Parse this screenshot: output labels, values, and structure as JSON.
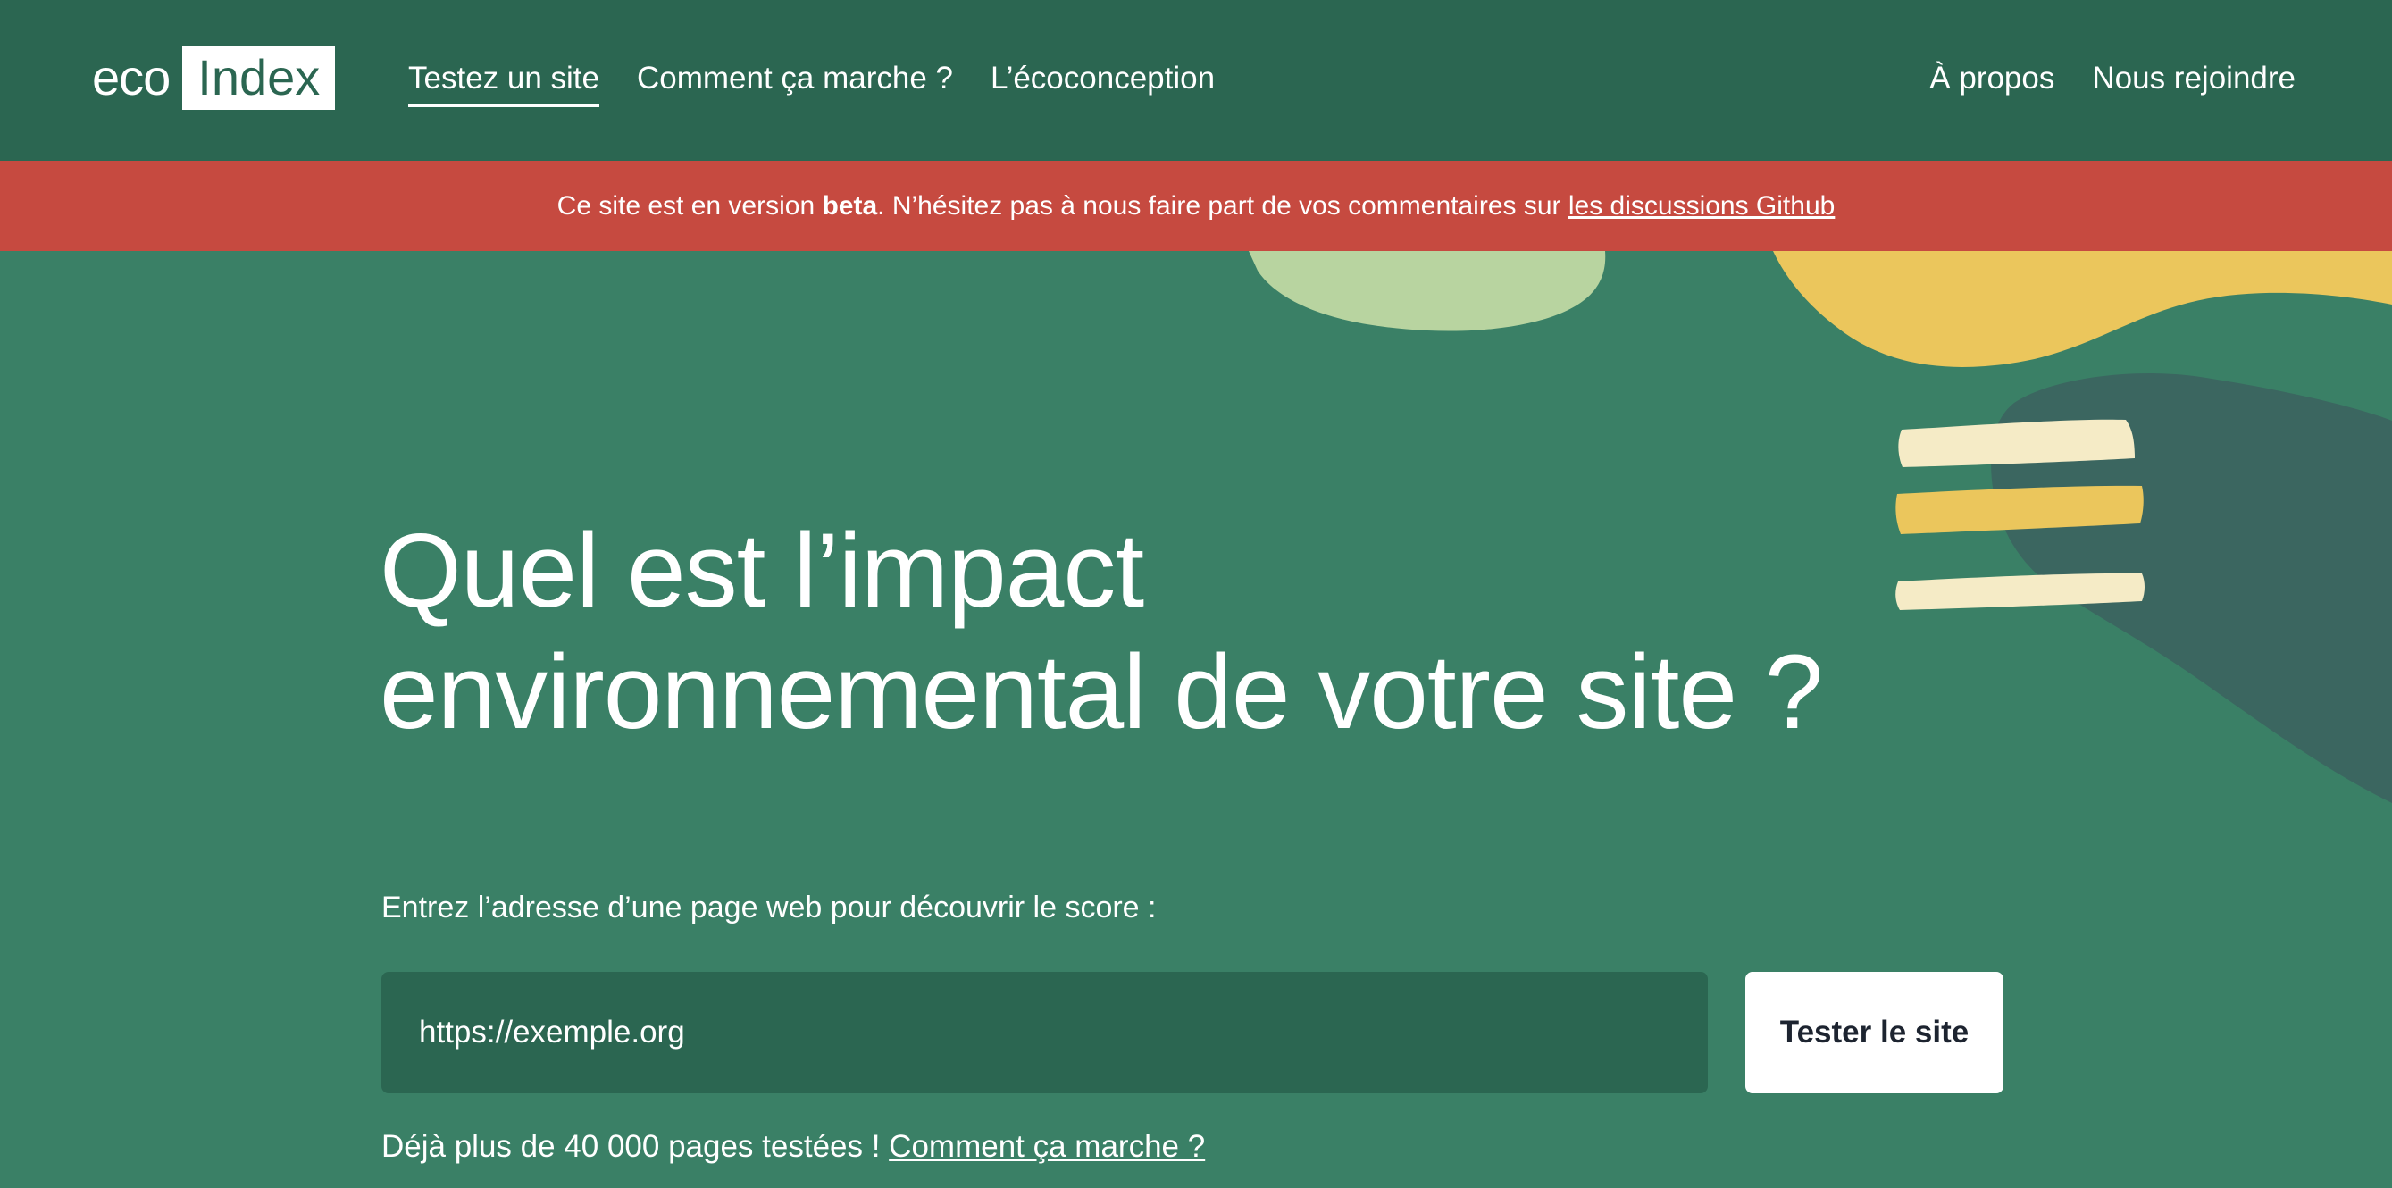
{
  "header": {
    "logo": {
      "part1": "eco",
      "part2": "Index"
    },
    "nav_left": [
      {
        "label": "Testez un site",
        "active": true
      },
      {
        "label": "Comment ça marche ?"
      },
      {
        "label": "L’écoconception"
      }
    ],
    "nav_right": [
      {
        "label": "À propos"
      },
      {
        "label": "Nous rejoindre"
      }
    ]
  },
  "banner": {
    "text_before": "Ce site est en version ",
    "bold": "beta",
    "text_after": ". N’hésitez pas à nous faire part de vos commentaires sur ",
    "link": "les discussions Github"
  },
  "hero": {
    "title_line1": "Quel est l’impact",
    "title_line2": "environnemental de votre site ?",
    "prompt": "Entrez l’adresse d’une page web pour découvrir le score :",
    "input_placeholder": "https://exemple.org",
    "button": "Tester le site",
    "footnote_text": "Déjà plus de 40 000 pages testées ! ",
    "footnote_link": "Comment ça marche ?"
  },
  "colors": {
    "header_bg": "#2b6651",
    "banner_bg": "#c64a40",
    "hero_bg": "#3a8066",
    "input_bg": "#2b6651",
    "blob_light_green": "#b8d4a0",
    "blob_yellow": "#ebc65c",
    "blob_dark": "#3b6660",
    "stripe_cream": "#f5ebc6"
  }
}
